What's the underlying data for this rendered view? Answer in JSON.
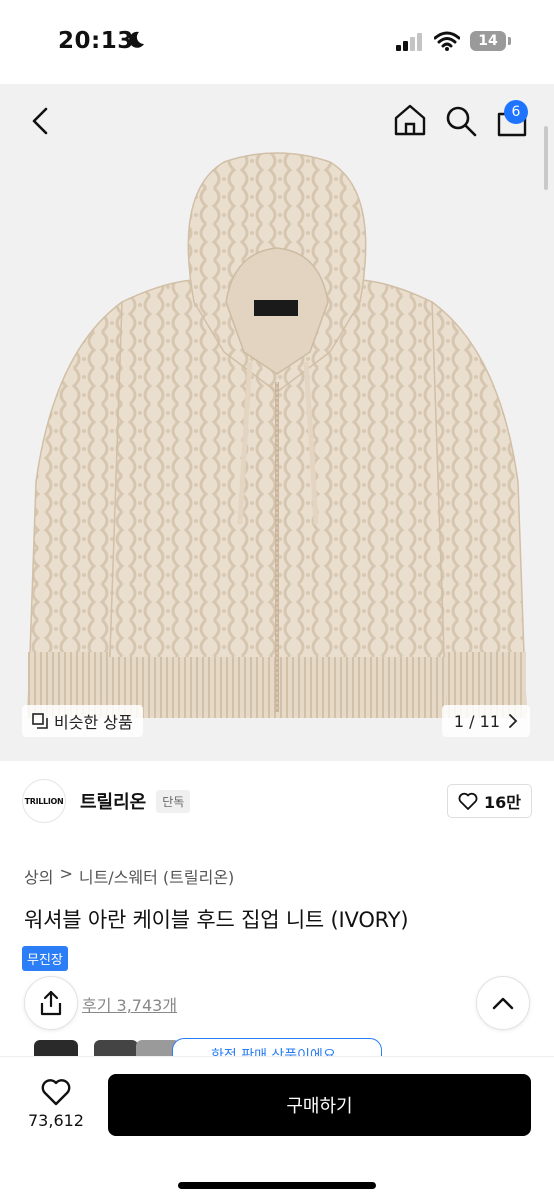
{
  "status": {
    "time": "20:13",
    "battery": "14"
  },
  "nav": {
    "cart_count": "6"
  },
  "hero": {
    "similar_label": "비슷한 상품",
    "page_indicator": "1 / 11"
  },
  "brand": {
    "logo_text": "TRILLION",
    "name": "트릴리온",
    "tag": "단독",
    "likes": "16만"
  },
  "breadcrumb": {
    "level1": "상의",
    "separator": ">",
    "level2": "니트/스웨터 (트릴리온)"
  },
  "product": {
    "title": "워셔블 아란 케이블 후드 집업 니트 (IVORY)",
    "badge": "무진장",
    "reviews": "후기 3,743개",
    "notice": "한정 판매 상품이에요"
  },
  "bottom": {
    "wish_count": "73,612",
    "buy_label": "구매하기"
  },
  "colors": {
    "accent": "#2c7ef7",
    "badge": "#1e74ff",
    "knit": "#e9dccb",
    "hero_bg": "#f1f1f1"
  }
}
